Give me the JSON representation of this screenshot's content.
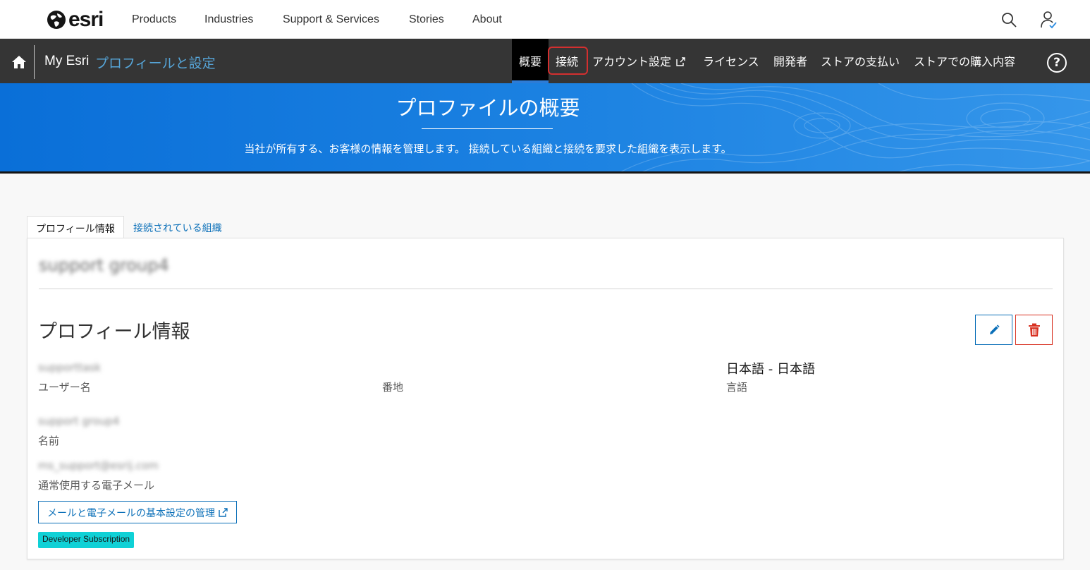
{
  "topnav": {
    "logo_text": "esri",
    "items": [
      "Products",
      "Industries",
      "Support & Services",
      "Stories",
      "About"
    ]
  },
  "subbar": {
    "brand": "My Esri",
    "section": "プロフィールと設定",
    "nav": {
      "overview": "概要",
      "connections": "接続",
      "account_settings": "アカウント設定",
      "licenses": "ライセンス",
      "developers": "開発者",
      "store_payments": "ストアの支払い",
      "store_purchases": "ストアでの購入内容"
    },
    "help": "?"
  },
  "banner": {
    "title": "プロファイルの概要",
    "description": "当社が所有する、お客様の情報を管理します。 接続している組織と接続を要求した組織を表示します。"
  },
  "tabs": {
    "profile": "プロフィール情報",
    "connected_orgs": "接続されている組織"
  },
  "card": {
    "org_name": "support group4",
    "section_title": "プロフィール情報",
    "fields": {
      "username_value": "supporttask",
      "username_label": "ユーザー名",
      "address_label": "番地",
      "language_value": "日本語 - 日本語",
      "language_label": "言語",
      "name_value": "support group4",
      "name_label": "名前",
      "email_value": "ms_support@esrij.com",
      "email_label": "通常使用する電子メール"
    },
    "manage_button": "メールと電子メールの基本設定の管理",
    "badge": "Developer Subscription"
  },
  "colors": {
    "accent": "#0a6fb8",
    "banner": "#1d83e2",
    "subbar": "#353535",
    "danger": "#d83020",
    "badge": "#0fd1d6",
    "highlight": "#d32f2f"
  }
}
